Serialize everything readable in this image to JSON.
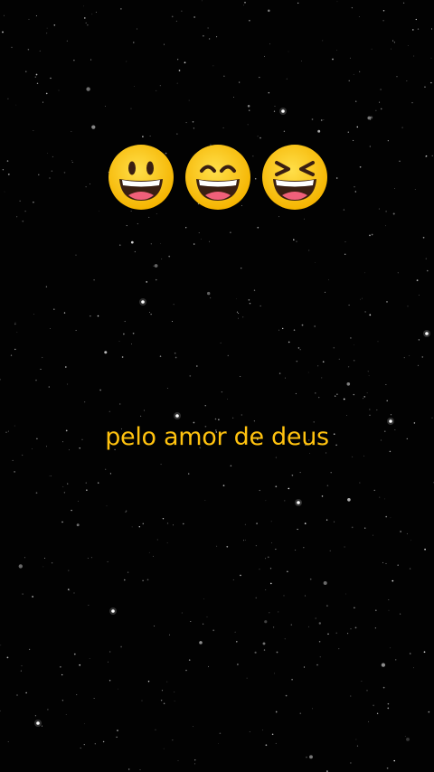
{
  "caption": {
    "text": "pelo amor de deus",
    "color": "#ffc20f"
  },
  "emojis": [
    {
      "icon": "grinning-face-icon"
    },
    {
      "icon": "grinning-face-with-smiling-eyes-icon"
    },
    {
      "icon": "grinning-squinting-face-icon"
    }
  ],
  "colors": {
    "background": "#020202",
    "emoji_face": "#fcc21b",
    "emoji_outline": "#e6a100",
    "emoji_mouth": "#3a1f12",
    "emoji_teeth": "#ffffff",
    "emoji_tongue": "#f0607a"
  }
}
